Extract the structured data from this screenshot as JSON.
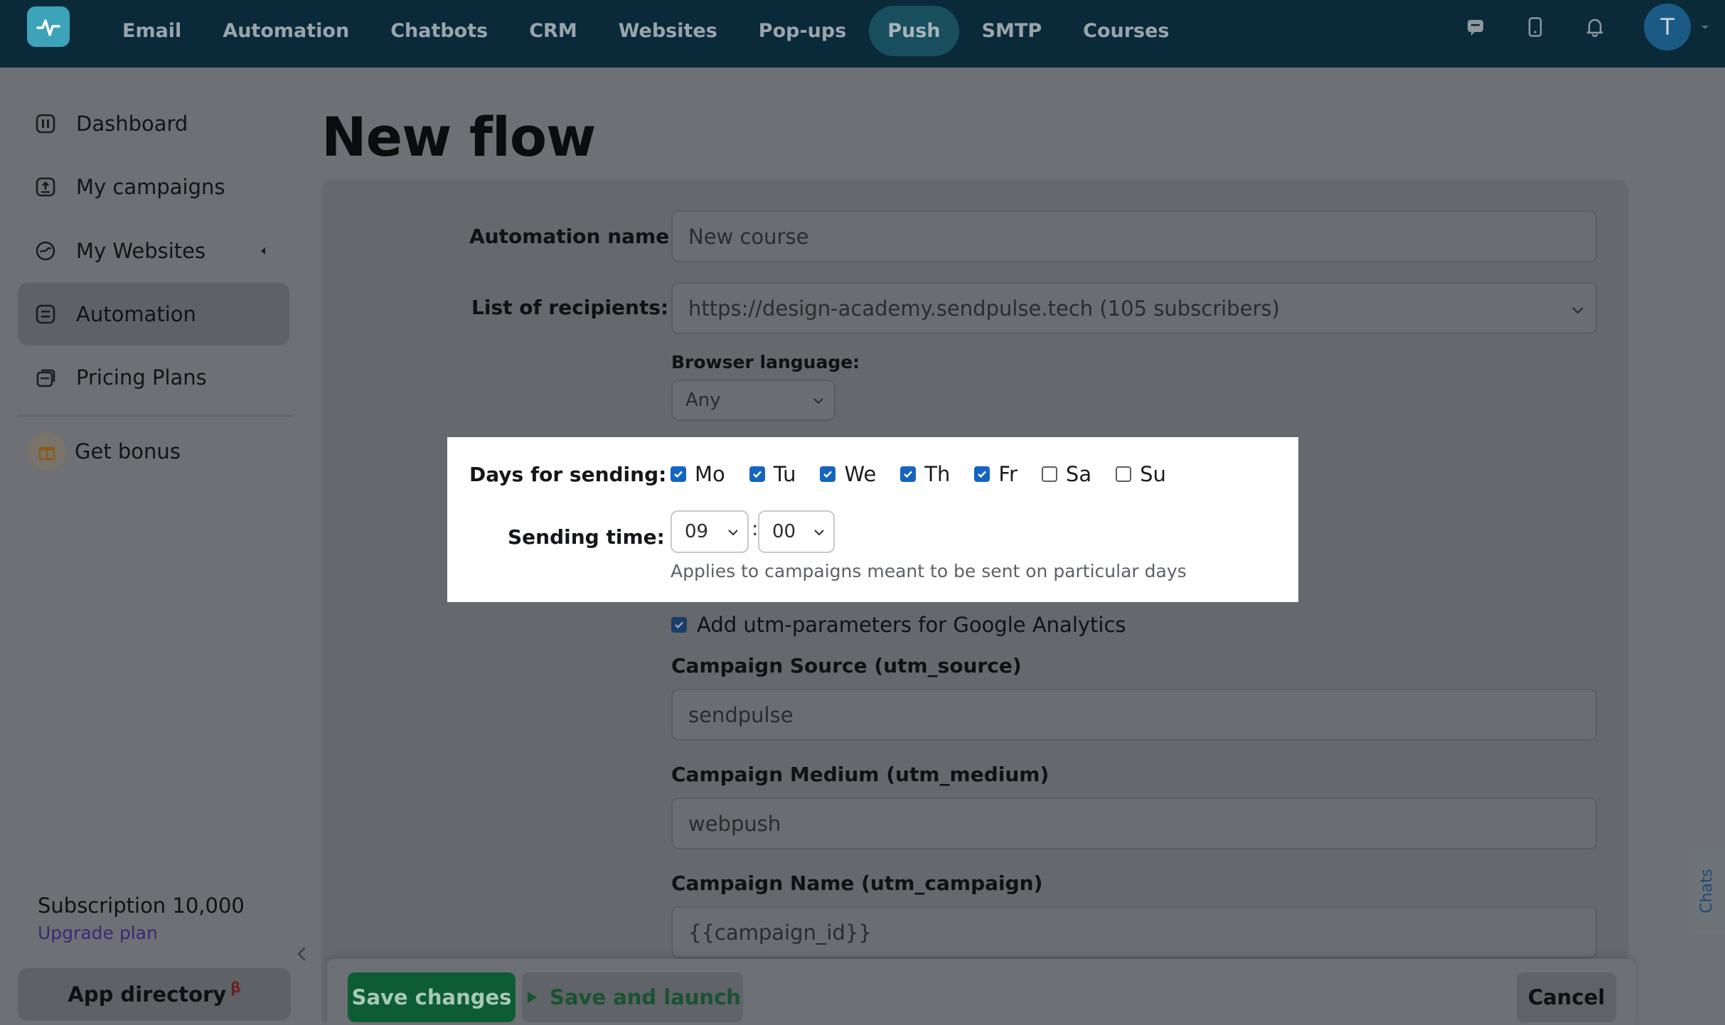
{
  "topnav": {
    "items": [
      {
        "label": "Email"
      },
      {
        "label": "Automation"
      },
      {
        "label": "Chatbots"
      },
      {
        "label": "CRM"
      },
      {
        "label": "Websites"
      },
      {
        "label": "Pop-ups"
      },
      {
        "label": "Push",
        "active": true
      },
      {
        "label": "SMTP"
      },
      {
        "label": "Courses"
      }
    ],
    "avatar_letter": "T",
    "icons": [
      "chat-icon",
      "mobile-icon",
      "bell-icon",
      "logo-icon"
    ]
  },
  "sidebar": {
    "items": [
      {
        "label": "Dashboard",
        "icon": "dashboard-icon"
      },
      {
        "label": "My campaigns",
        "icon": "campaigns-icon"
      },
      {
        "label": "My Websites",
        "icon": "websites-icon"
      },
      {
        "label": "Automation",
        "icon": "automation-icon",
        "active": true
      },
      {
        "label": "Pricing Plans",
        "icon": "pricing-icon"
      }
    ],
    "bonus_label": "Get bonus",
    "subscription": "Subscription 10,000",
    "upgrade": "Upgrade plan",
    "app_directory": "App directory",
    "beta_mark": "β"
  },
  "page": {
    "title": "New flow"
  },
  "form": {
    "automation_name_label": "Automation name",
    "automation_name_value": "New course",
    "recipients_label": "List of recipients:",
    "recipients_value": "https://design-academy.sendpulse.tech (105 subscribers)",
    "browser_language_label": "Browser language:",
    "browser_language_value": "Any",
    "days_label": "Days for sending:",
    "days": [
      {
        "label": "Mo",
        "checked": true
      },
      {
        "label": "Tu",
        "checked": true
      },
      {
        "label": "We",
        "checked": true
      },
      {
        "label": "Th",
        "checked": true
      },
      {
        "label": "Fr",
        "checked": true
      },
      {
        "label": "Sa",
        "checked": false
      },
      {
        "label": "Su",
        "checked": false
      }
    ],
    "sending_time_label": "Sending time:",
    "hour": "09",
    "time_separator": ":",
    "minute": "00",
    "time_hint": "Applies to campaigns meant to be sent on particular days",
    "utm_label": "Add utm-parameters for Google Analytics",
    "utm_checked": true,
    "source_label": "Campaign Source (utm_source)",
    "source_value": "sendpulse",
    "medium_label": "Campaign Medium (utm_medium)",
    "medium_value": "webpush",
    "name_label": "Campaign Name (utm_campaign)",
    "name_value": "{{campaign_id}}"
  },
  "footer": {
    "save": "Save changes",
    "launch": "Save and launch",
    "cancel": "Cancel"
  },
  "chats_tab": "Chats",
  "colors": {
    "topbar": "#0a2a3a",
    "overlay_bg": "#6e7075",
    "primary_green": "#0e5c33",
    "checkbox_blue": "#1565c0"
  }
}
